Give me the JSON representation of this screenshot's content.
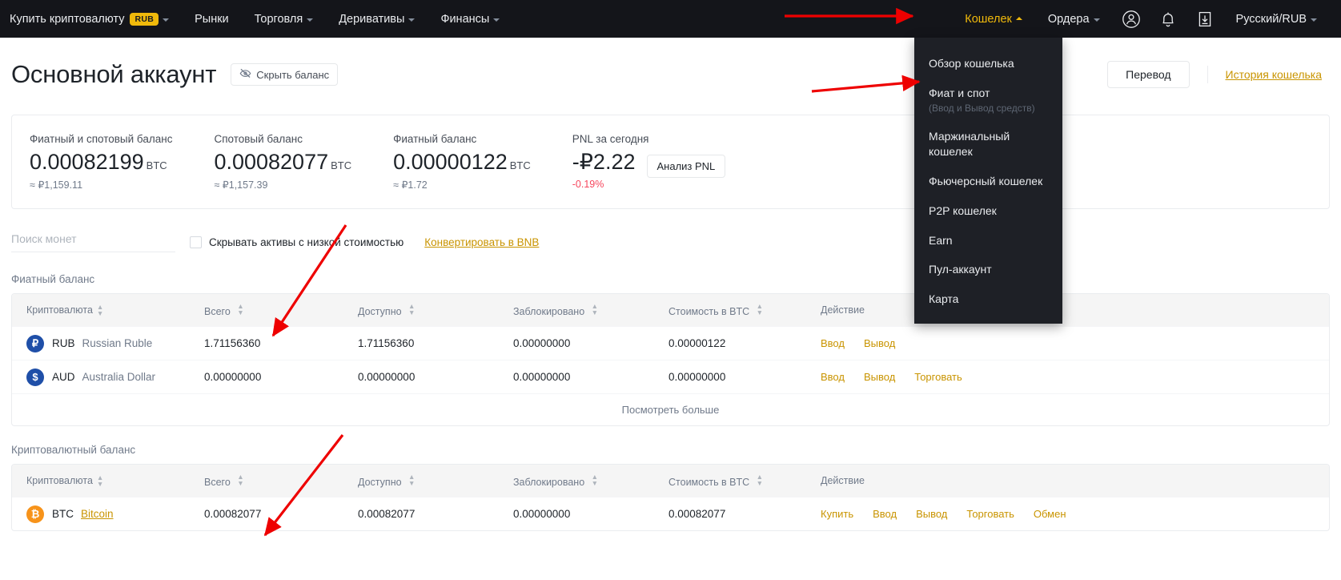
{
  "navbar": {
    "left_items": [
      {
        "label": "Купить криптовалюту",
        "badge": "RUB",
        "caret": "down"
      },
      {
        "label": "Рынки",
        "caret": "none"
      },
      {
        "label": "Торговля",
        "caret": "down"
      },
      {
        "label": "Деривативы",
        "caret": "down"
      },
      {
        "label": "Финансы",
        "caret": "down"
      }
    ],
    "right_items": [
      {
        "label": "Кошелек",
        "caret": "up",
        "active": true
      },
      {
        "label": "Ордера",
        "caret": "down",
        "active": false
      }
    ],
    "icons": [
      "user-icon",
      "bell-icon",
      "download-icon"
    ],
    "locale": "Русский/RUB"
  },
  "wallet_menu": {
    "items": [
      {
        "label": "Обзор кошелька",
        "sub": ""
      },
      {
        "label": "Фиат и спот",
        "sub": "(Ввод и Вывод средств)"
      },
      {
        "label": "Маржинальный кошелек",
        "sub": ""
      },
      {
        "label": "Фьючерсный кошелек",
        "sub": ""
      },
      {
        "label": "P2P кошелек",
        "sub": ""
      },
      {
        "label": "Earn",
        "sub": ""
      },
      {
        "label": "Пул-аккаунт",
        "sub": ""
      },
      {
        "label": "Карта",
        "sub": ""
      }
    ]
  },
  "header": {
    "title": "Основной аккаунт",
    "hide_balance": "Скрыть баланс",
    "transfer": "Перевод",
    "wallet_history": "История кошелька"
  },
  "balances": [
    {
      "label": "Фиатный и спотовый баланс",
      "value": "0.00082199",
      "unit": "BTC",
      "approx": "≈ ₽1,159.11"
    },
    {
      "label": "Спотовый баланс",
      "value": "0.00082077",
      "unit": "BTC",
      "approx": "≈ ₽1,157.39"
    },
    {
      "label": "Фиатный баланс",
      "value": "0.00000122",
      "unit": "BTC",
      "approx": "≈ ₽1.72"
    }
  ],
  "pnl": {
    "label": "PNL за сегодня",
    "value": "-₽2.22",
    "percent": "-0.19%",
    "button": "Анализ PNL"
  },
  "filters": {
    "search_placeholder": "Поиск монет",
    "search_value": "",
    "hide_low_value": "Скрывать активы с низкой стоимостью",
    "hide_low_value_checked": false,
    "convert_link": "Конвертировать в BNB"
  },
  "columns": [
    "Криптовалюта",
    "Всего",
    "Доступно",
    "Заблокировано",
    "Стоимость в BTC",
    "Действие"
  ],
  "fiat_section": {
    "title": "Фиатный баланс",
    "rows": [
      {
        "icon_text": "₽",
        "icon_color": "#1f4fa8",
        "symbol": "RUB",
        "name": "Russian Ruble",
        "total": "1.71156360",
        "available": "1.71156360",
        "locked": "0.00000000",
        "btc_value": "0.00000122",
        "actions": [
          "Ввод",
          "Вывод"
        ]
      },
      {
        "icon_text": "$",
        "icon_color": "#1f4fa8",
        "symbol": "AUD",
        "name": "Australia Dollar",
        "total": "0.00000000",
        "available": "0.00000000",
        "locked": "0.00000000",
        "btc_value": "0.00000000",
        "actions": [
          "Ввод",
          "Вывод",
          "Торговать"
        ]
      }
    ],
    "see_more": "Посмотреть больше"
  },
  "crypto_section": {
    "title": "Криптовалютный баланс",
    "rows": [
      {
        "icon_text": "₿",
        "icon_color": "#f7931a",
        "symbol": "BTC",
        "name": "Bitcoin",
        "name_link": true,
        "total": "0.00082077",
        "available": "0.00082077",
        "locked": "0.00000000",
        "btc_value": "0.00082077",
        "actions": [
          "Купить",
          "Ввод",
          "Вывод",
          "Торговать",
          "Обмен"
        ]
      }
    ]
  },
  "colors": {
    "accent": "#f0b90b",
    "link": "#c99400",
    "nav_bg": "#14151a",
    "menu_bg": "#1e2026",
    "negative": "#f6465d",
    "annotation": "#ee0000"
  }
}
